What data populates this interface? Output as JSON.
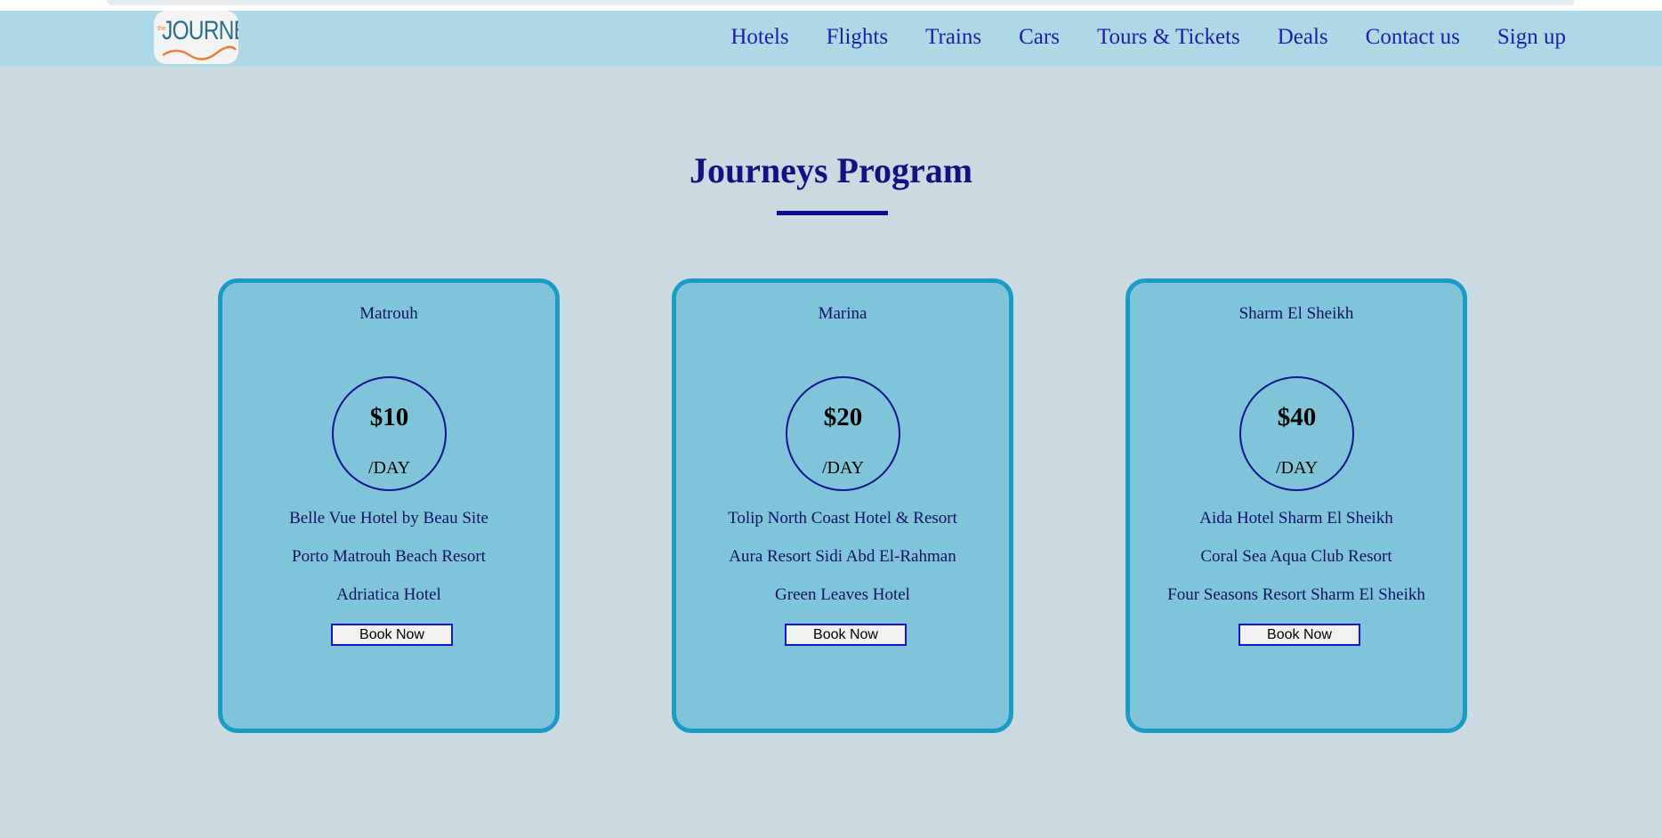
{
  "brand": {
    "logo_text": "JOURNEY",
    "logo_small": "the"
  },
  "nav": {
    "items": [
      {
        "label": "Hotels"
      },
      {
        "label": "Flights"
      },
      {
        "label": "Trains"
      },
      {
        "label": "Cars"
      },
      {
        "label": "Tours & Tickets"
      },
      {
        "label": "Deals"
      },
      {
        "label": "Contact us"
      },
      {
        "label": "Sign up"
      }
    ]
  },
  "main": {
    "title": "Journeys Program",
    "cards": [
      {
        "city": "Matrouh",
        "price": "$10",
        "unit": "/DAY",
        "hotels": [
          "Belle Vue Hotel by Beau Site",
          "Porto Matrouh Beach Resort",
          "Adriatica Hotel"
        ],
        "button": "Book Now"
      },
      {
        "city": "Marina",
        "price": "$20",
        "unit": "/DAY",
        "hotels": [
          "Tolip North Coast Hotel & Resort",
          "Aura Resort Sidi Abd El-Rahman",
          "Green Leaves Hotel"
        ],
        "button": "Book Now"
      },
      {
        "city": "Sharm El Sheikh",
        "price": "$40",
        "unit": "/DAY",
        "hotels": [
          "Aida Hotel Sharm El Sheikh",
          "Coral Sea Aqua Club Resort",
          "Four Seasons Resort Sharm El Sheikh"
        ],
        "button": "Book Now"
      }
    ]
  },
  "colors": {
    "page_bg": "#cbdae1",
    "navbar_bg": "#add8e6",
    "nav_text": "#1e1ea8",
    "heading": "#121283",
    "card_bg": "#80c4d9",
    "card_border": "#1a9bc8",
    "button_border": "#1515d0"
  }
}
